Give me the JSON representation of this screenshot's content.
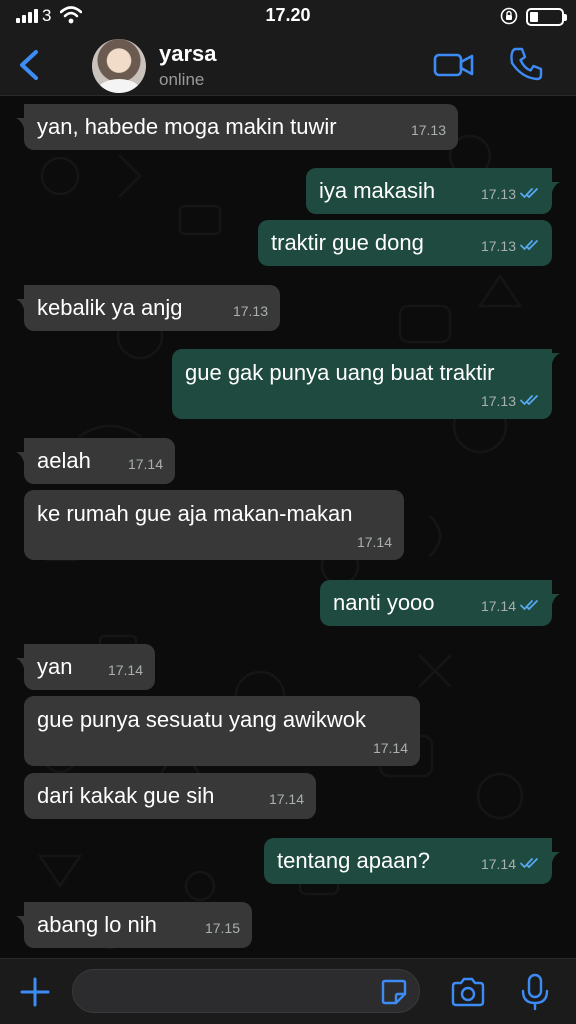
{
  "status_bar": {
    "carrier": "3",
    "time": "17.20"
  },
  "header": {
    "contact_name": "yarsa",
    "contact_status": "online"
  },
  "messages": [
    {
      "dir": "in",
      "text": "yan, habede moga makin tuwir",
      "time": "17.13"
    },
    {
      "dir": "out",
      "text": "iya makasih",
      "time": "17.13",
      "read": true
    },
    {
      "dir": "out",
      "text": "traktir gue dong",
      "time": "17.13",
      "read": true
    },
    {
      "dir": "in",
      "text": "kebalik ya anjg",
      "time": "17.13"
    },
    {
      "dir": "out",
      "text": "gue gak punya uang buat traktir",
      "time": "17.13",
      "read": true
    },
    {
      "dir": "in",
      "text": "aelah",
      "time": "17.14"
    },
    {
      "dir": "in",
      "text": "ke rumah gue aja makan-makan",
      "time": "17.14"
    },
    {
      "dir": "out",
      "text": "nanti yooo",
      "time": "17.14",
      "read": true
    },
    {
      "dir": "in",
      "text": "yan",
      "time": "17.14"
    },
    {
      "dir": "in",
      "text": "gue punya sesuatu yang awikwok",
      "time": "17.14"
    },
    {
      "dir": "in",
      "text": "dari kakak gue sih",
      "time": "17.14"
    },
    {
      "dir": "out",
      "text": "tentang apaan?",
      "time": "17.14",
      "read": true
    },
    {
      "dir": "in",
      "text": "abang lo nih",
      "time": "17.15"
    }
  ],
  "input": {
    "value": "",
    "placeholder": ""
  },
  "icons": {
    "back": "chevron-left-icon",
    "video": "video-camera-icon",
    "call": "phone-icon",
    "attach": "plus-icon",
    "sticker": "sticker-icon",
    "camera": "camera-icon",
    "mic": "microphone-icon",
    "read_receipt": "double-check-icon"
  },
  "colors": {
    "accent": "#3d8cf5",
    "incoming_bubble": "#383838",
    "outgoing_bubble": "#1f4a3f",
    "read_tick": "#54a8f0",
    "background": "#0c0c0c"
  }
}
